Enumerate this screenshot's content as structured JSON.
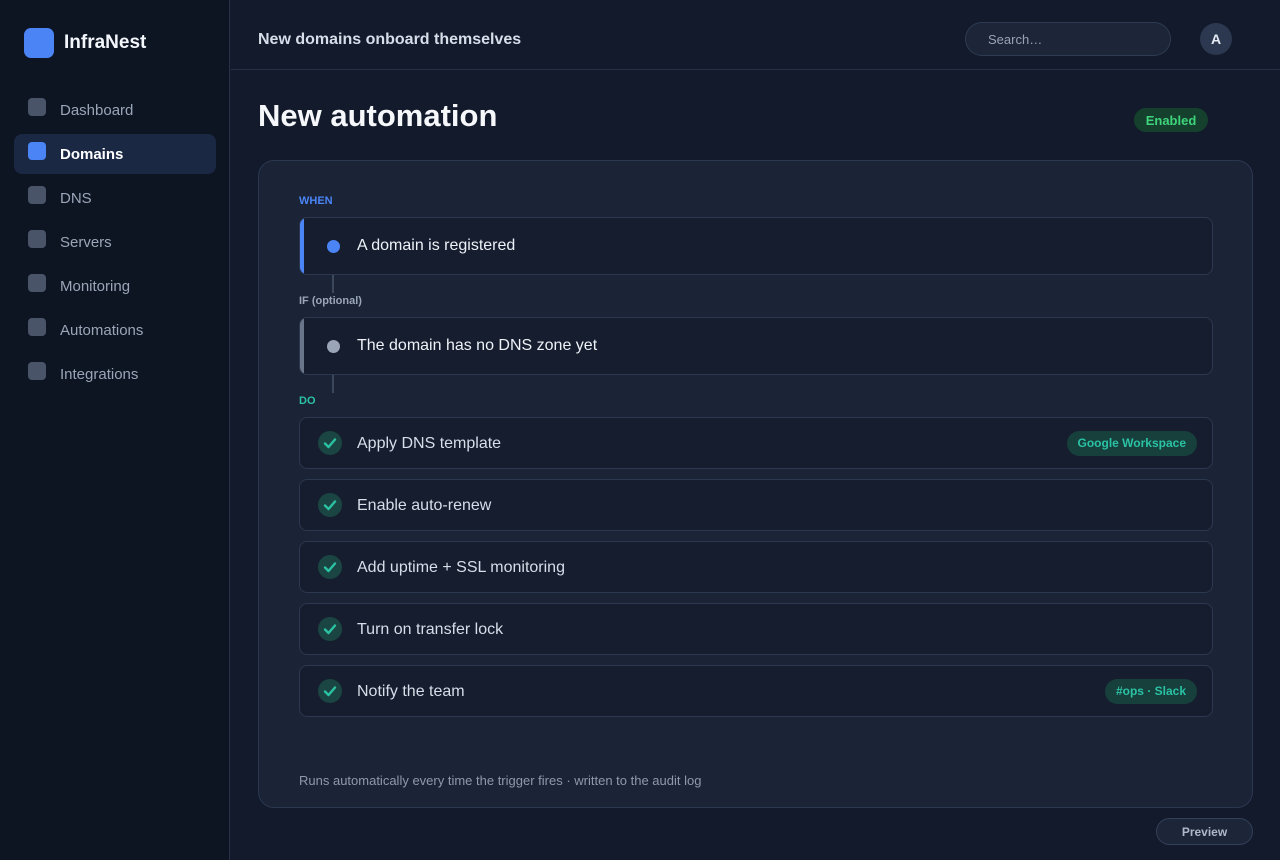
{
  "app": {
    "name": "InfraNest",
    "logo_color": "#4b84f5"
  },
  "sidebar": {
    "items": [
      {
        "label": "Dashboard",
        "icon": "dashboard-icon",
        "active": false
      },
      {
        "label": "Domains",
        "icon": "domains-icon",
        "active": true
      },
      {
        "label": "DNS",
        "icon": "dns-icon",
        "active": false
      },
      {
        "label": "Servers",
        "icon": "servers-icon",
        "active": false
      },
      {
        "label": "Monitoring",
        "icon": "monitoring-icon",
        "active": false
      },
      {
        "label": "Automations",
        "icon": "automations-icon",
        "active": false
      },
      {
        "label": "Integrations",
        "icon": "integrations-icon",
        "active": false
      }
    ]
  },
  "topbar": {
    "title": "New domains onboard themselves",
    "search_placeholder": "Search…",
    "avatar_initial": "A"
  },
  "page": {
    "title": "New automation",
    "status": "Enabled",
    "status_color": "#3fd37c"
  },
  "rule": {
    "when": {
      "label": "WHEN",
      "text": "A domain is registered",
      "color": "#4b84f5"
    },
    "if": {
      "label": "IF (optional)",
      "text": "The domain has no DNS zone yet",
      "color": "#9aa6b8"
    },
    "do": {
      "label": "DO",
      "color": "#2bc2a4",
      "actions": [
        {
          "text": "Apply DNS template",
          "tag": "Google Workspace"
        },
        {
          "text": "Enable auto-renew",
          "tag": ""
        },
        {
          "text": "Add uptime + SSL monitoring",
          "tag": ""
        },
        {
          "text": "Turn on transfer lock",
          "tag": ""
        },
        {
          "text": "Notify the team",
          "tag": "#ops · Slack"
        }
      ]
    }
  },
  "footnote": "Runs automatically every time the trigger fires · written to the audit log",
  "preview_label": "Preview"
}
